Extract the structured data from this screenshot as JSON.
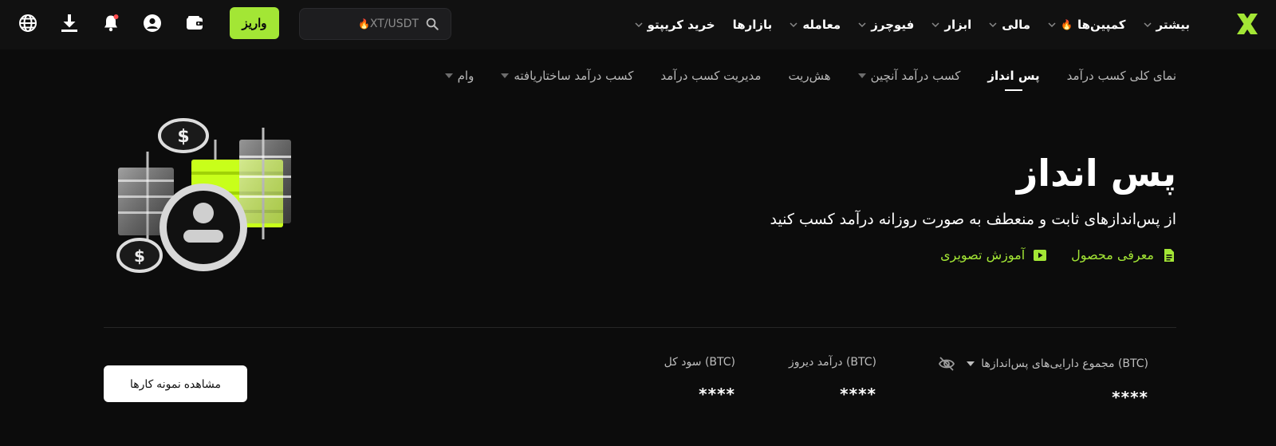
{
  "nav": {
    "items": [
      {
        "label": "خرید کریپتو",
        "chevron": true,
        "fire": false
      },
      {
        "label": "بازارها",
        "chevron": false,
        "fire": false
      },
      {
        "label": "معامله",
        "chevron": true,
        "fire": false
      },
      {
        "label": "فیوچرز",
        "chevron": true,
        "fire": false
      },
      {
        "label": "ابزار",
        "chevron": true,
        "fire": false
      },
      {
        "label": "مالی",
        "chevron": true,
        "fire": false
      },
      {
        "label": "کمپین‌ها",
        "chevron": true,
        "fire": true
      },
      {
        "label": "بیشتر",
        "chevron": true,
        "fire": false
      }
    ],
    "search_text": "XT/USDT",
    "deposit_label": "واریز"
  },
  "subnav": {
    "items": [
      {
        "label": "نمای کلی کسب درآمد",
        "caret": false,
        "active": false
      },
      {
        "label": "پس انداز",
        "caret": false,
        "active": true
      },
      {
        "label": "کسب درآمد آنچین",
        "caret": true,
        "active": false
      },
      {
        "label": "هش‌ریت",
        "caret": false,
        "active": false
      },
      {
        "label": "مدیریت کسب درآمد",
        "caret": false,
        "active": false
      },
      {
        "label": "کسب درآمد ساختاریافته",
        "caret": true,
        "active": false
      },
      {
        "label": "وام",
        "caret": true,
        "active": false
      }
    ]
  },
  "hero": {
    "title": "پس انداز",
    "subtitle": "از پس‌اندازهای ثابت و منعطف به صورت روزانه درآمد کسب کنید",
    "product_intro": "معرفی محصول",
    "video_tutorial": "آموزش تصویری"
  },
  "stats": {
    "total_assets_label": "مجموع دارایی‌های پس‌اندازها (BTC)",
    "total_assets_value": "****",
    "yesterday_label": "درآمد دیروز (BTC)",
    "yesterday_value": "****",
    "total_profit_label": "سود کل (BTC)",
    "total_profit_value": "****",
    "sample_button": "مشاهده نمونه کارها"
  },
  "colors": {
    "accent": "#a3e635",
    "background": "#0c0c0c",
    "topbar": "#111111"
  }
}
